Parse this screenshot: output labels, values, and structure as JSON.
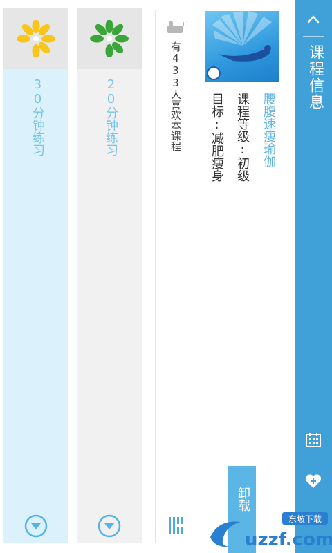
{
  "header": {
    "title": "课程信息"
  },
  "course": {
    "name": "腰腹速瘦瑜伽",
    "level": "课程等级:初级",
    "goal": "目标:减肥瘦身",
    "likes_text": "有433人喜欢本课程",
    "uninstall_label": "卸载"
  },
  "sessions": [
    {
      "label": "20分钟练习",
      "flower_color": "#3aa63a"
    },
    {
      "label": "30分钟练习",
      "flower_color": "#f7c51b"
    }
  ],
  "colors": {
    "accent": "#3fa1d8",
    "course_name": "#63b5e0",
    "session_label": "#78c3e8",
    "button": "#5bb6e6"
  },
  "watermark": {
    "text_top": "东坡下载",
    "text_main": "uzzf.com"
  },
  "icons": [
    "back-chevron-icon",
    "calendar-icon",
    "heart-plus-icon",
    "thumbs-up-icon",
    "list-icon",
    "play-down-icon",
    "lotus-icon"
  ]
}
